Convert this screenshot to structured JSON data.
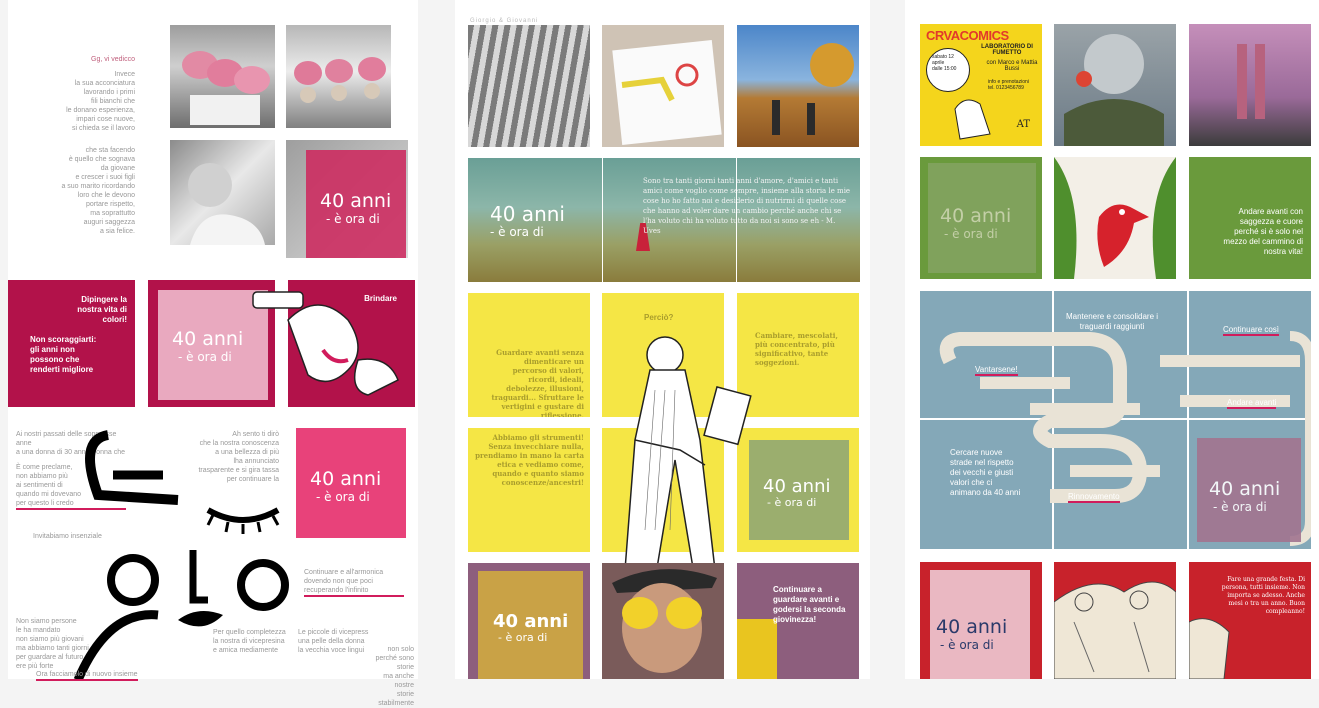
{
  "colors": {
    "crimson": "#b2124a",
    "pink": "#e8427a",
    "lightpink": "#e9a9bf",
    "yellow": "#f5e645",
    "teal": "#5f9a92",
    "mauve": "#8d5e7d",
    "gold": "#c9a246",
    "olive": "#9bae6e",
    "slate": "#84a8b8",
    "green": "#6a9a3c",
    "red": "#c8222b"
  },
  "brand": {
    "main": "40 anni",
    "sub": "- è ora di"
  },
  "panel1": {
    "poem_top": [
      "Gg, vi vedicco",
      "Invece",
      "la sua acconciatura",
      "lavorando i primi",
      "fili bianchi che",
      "le donano esperienza,",
      "impari cose nuove,",
      "si chieda se il lavoro"
    ],
    "poem_mid": [
      "che sta facendo",
      "è quello che sognava",
      "da giovane",
      "e crescer i suoi figli",
      "a suo marito ricordando",
      "loro che le devono",
      "portare rispetto,",
      "ma soprattutto",
      "auguri saggezza",
      "a sia felice."
    ],
    "dipingere": "Dipingere la nostra vita di colori!",
    "non_scoraggiarti": "Non scoraggiarti: gli anni non possono che renderti migliore",
    "brindare": "Brindare",
    "poem_face_left": [
      "Ai nostri passati delle soppresse anne",
      "a una donna di 30 anni. Donna che",
      "È come preclame,",
      "non abbiamo più",
      "ai sentimenti di",
      "quando mi dovevano",
      "per questo li credo"
    ],
    "poem_face_right": [
      "Ah sento ti dirò",
      "che la nostra conoscenza",
      "a una bellezza di più",
      "lha annunciato",
      "trasparente e si gira tassa",
      "per continuare la"
    ],
    "invitare": "Invitabiamo insenziale",
    "bottom_texts": [
      "Non siamo persone",
      "le ha mandato",
      "non siamo più giovani",
      "ma abbiamo tanti giorni",
      "per guardare al futuro",
      "ere più forte",
      "Ora facciamolo di nuovo insieme",
      "Per quello completezza",
      "la nostra di vicepresina",
      "e amica mediamente",
      "Le piccole di vicepress",
      "una pelle della donna",
      "la vecchia voce lingui",
      "Continuare e all'armonica",
      "dovendo non que poci",
      "recuperando l'infinito",
      "non solo",
      "perché sono storie",
      "ma anche nostre",
      "storie stabilmente"
    ]
  },
  "panel2": {
    "label_top": "Giorgio & Giovanni",
    "poem": "Sono tra tanti giorni tanti anni d'amore, d'amici e tanti amici come voglio come sempre, insieme alla storia le mie cose ho ho fatto noi e desiderio di nutrirmi di quelle cose che hanno ad voler dare un cambio perché anche chi se l'ha voluto chi ha voluto tutto da noi si sono se eh - M. Uves",
    "perciò": "Perciò?",
    "guardare": "Guardare avanti senza dimenticare un percorso di valori, ricordi, ideali, debolezze, illusioni, traguardi... Sfruttare le vertigini e gustare di riflessione.",
    "cambiare": "Cambiare, mescolati, più concentrato, più significativo, tante soggezioni.",
    "abbiamo": "Abbiamo gli strumenti! Senza invecchiare nulla, prendiamo in mano la carta etica e vediamo come, quando e quanto siamo conoscenze/ancestri!",
    "continuare": "Continuare a guardare avanti e godersi la seconda giovinezza!"
  },
  "panel3": {
    "comics_title": "CRVACOMICS",
    "comics_sub": "LABORATORIO DI FUMETTO",
    "comics_with": "con Marco e Mattia Bussi",
    "comics_info": [
      "sabato 12 aprile",
      "dalle 15:00",
      "info e prenotazioni",
      "tel. 0123456789"
    ],
    "comics_logo": "AT",
    "andare": "Andare avanti con saggezza e cuore perché si è solo nel mezzo del cammino di nostra vita!",
    "mantenere": "Mantenere e consolidare i traguardi raggiunti",
    "continuare_cosi": "Continuare così",
    "vantarsene": "Vantarsene!",
    "andare_avanti": "Andare avanti",
    "cercare": "Cercare nuove strade nel rispetto dei vecchi e giusti valori che ci animano da 40 anni",
    "rinnovamento": "Rinnovamento",
    "festa": "Fare una grande festa. Di persona, tutti insieme. Non importa se adesso. Anche mesi o tra un anno. Buon compleanno!"
  }
}
